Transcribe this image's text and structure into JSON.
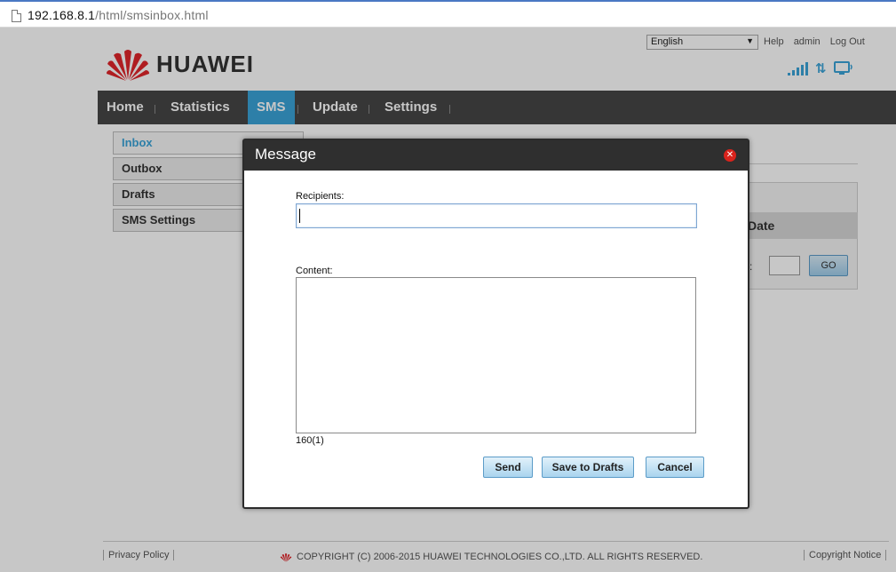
{
  "browser": {
    "url_host": "192.168.8.1",
    "url_path": "/html/smsinbox.html"
  },
  "header": {
    "brand": "HUAWEI",
    "language": "English",
    "links": [
      "Help",
      "admin",
      "Log Out"
    ],
    "network_type": "⇅"
  },
  "nav": {
    "items": [
      "Home",
      "Statistics",
      "SMS",
      "Update",
      "Settings"
    ],
    "active": "SMS"
  },
  "submenu": {
    "items": [
      "Inbox",
      "Outbox",
      "Drafts",
      "SMS Settings"
    ],
    "active": "Inbox"
  },
  "inbox": {
    "column_date": "Date",
    "go_label": "GO",
    "page_label": ":"
  },
  "modal": {
    "title": "Message",
    "recipients_label": "Recipients:",
    "recipients_value": "",
    "content_label": "Content:",
    "content_value": "",
    "counter": "160(1)",
    "buttons": {
      "send": "Send",
      "save_drafts": "Save to Drafts",
      "cancel": "Cancel"
    }
  },
  "footer": {
    "privacy": "Privacy Policy",
    "copyright": "COPYRIGHT (C) 2006-2015 HUAWEI TECHNOLOGIES CO.,LTD. ALL RIGHTS RESERVED.",
    "notice": "Copyright Notice"
  },
  "colors": {
    "accent": "#3aa3d8",
    "navbar": "#464646",
    "modal_header": "#2f2f2f",
    "brand_red": "#d9231c"
  }
}
